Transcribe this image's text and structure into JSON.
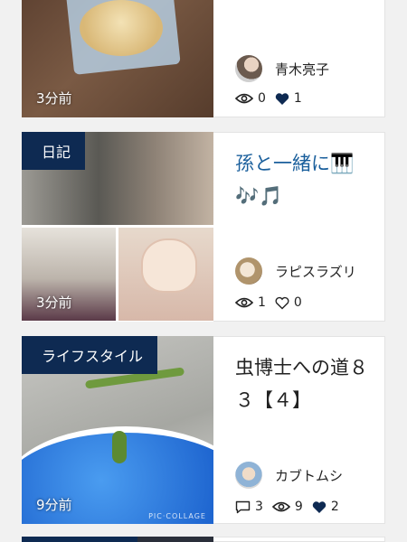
{
  "cards": [
    {
      "time": "3分前",
      "author": "青木亮子",
      "views": "0",
      "likes": "1"
    },
    {
      "category": "日記",
      "title": "孫と一緒に🎹🎶🎵",
      "time": "3分前",
      "author": "ラピスラズリ",
      "views": "1",
      "likes": "0"
    },
    {
      "category": "ライフスタイル",
      "title": "虫博士への道８３【４】",
      "time": "9分前",
      "author": "カブトムシ",
      "comments": "3",
      "views": "9",
      "likes": "2",
      "watermark": "PIC·COLLAGE"
    }
  ],
  "colors": {
    "category_bg": "#0e2a52",
    "title_link": "#1a5f9c",
    "text": "#222222"
  },
  "icons": [
    "eye-icon",
    "heart-filled-icon",
    "heart-outline-icon",
    "comment-icon"
  ]
}
